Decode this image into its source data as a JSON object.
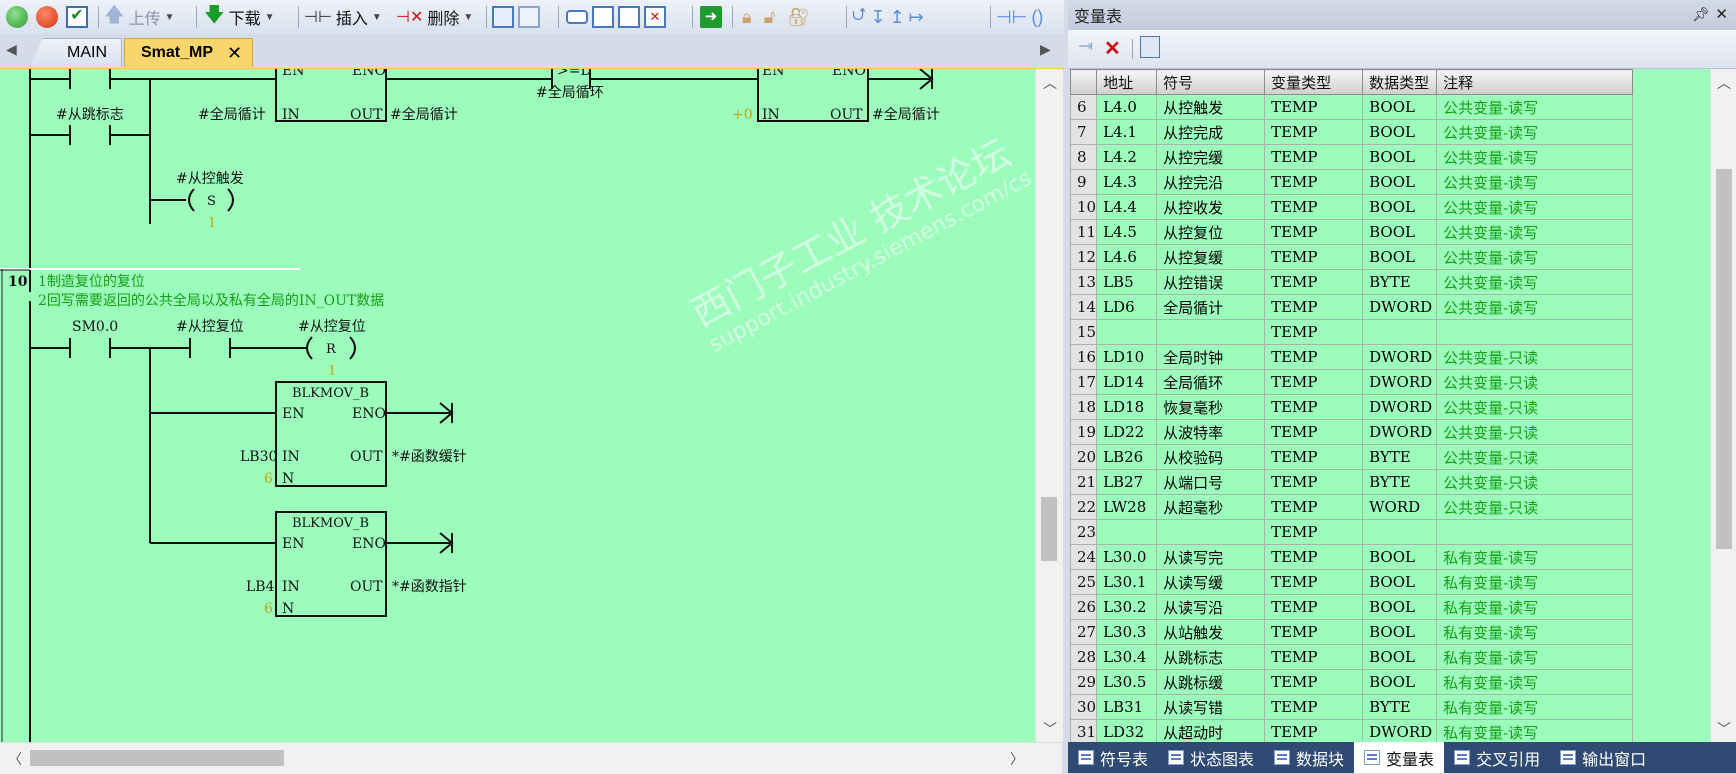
{
  "toolbar": {
    "upload": "上传",
    "download": "下载",
    "insert": "插入",
    "delete": "删除"
  },
  "editor_tabs": [
    {
      "label": "MAIN"
    },
    {
      "label": "Smat_MP"
    }
  ],
  "ladder": {
    "top": {
      "en": "EN",
      "eno": "ENO",
      "in": "IN",
      "out": "OUT",
      "contact2_label": "#从跳标志",
      "box1_in": "#全局循计",
      "box1_out": "#全局循计",
      "cmp_op": ">=D",
      "cmp_label": "#全局循环",
      "box2_in_value": "+0",
      "box2_out": "#全局循计",
      "set_coil_label": "#从控触发",
      "set_coil": "S",
      "set_n": "1"
    },
    "network10": {
      "number": "10",
      "comment1": "1制造复位的复位",
      "comment2": "2回写需要返回的公共全局以及私有全局的IN_OUT数据",
      "contact1": "SM0.0",
      "contact2": "#从控复位",
      "reset_label": "#从控复位",
      "reset_coil": "R",
      "reset_n": "1",
      "blk1": {
        "title": "BLKMOV_B",
        "in_src": "LB30",
        "n": "6",
        "out": "*#函数缓针"
      },
      "blk2": {
        "title": "BLKMOV_B",
        "in_src": "LB4",
        "n": "6",
        "out": "*#函数指针"
      },
      "en": "EN",
      "eno": "ENO",
      "in": "IN",
      "out": "OUT",
      "n_label": "N"
    }
  },
  "watermark": {
    "line1": "西门子工业 技术论坛",
    "line2": "support.industry.siemens.com/cs"
  },
  "panel": {
    "title": "变量表",
    "columns": [
      "地址",
      "符号",
      "变量类型",
      "数据类型",
      "注释"
    ],
    "rows": [
      [
        "6",
        "L4.0",
        "从控触发",
        "TEMP",
        "BOOL",
        "公共变量-读写"
      ],
      [
        "7",
        "L4.1",
        "从控完成",
        "TEMP",
        "BOOL",
        "公共变量-读写"
      ],
      [
        "8",
        "L4.2",
        "从控完缓",
        "TEMP",
        "BOOL",
        "公共变量-读写"
      ],
      [
        "9",
        "L4.3",
        "从控完沿",
        "TEMP",
        "BOOL",
        "公共变量-读写"
      ],
      [
        "10",
        "L4.4",
        "从控收发",
        "TEMP",
        "BOOL",
        "公共变量-读写"
      ],
      [
        "11",
        "L4.5",
        "从控复位",
        "TEMP",
        "BOOL",
        "公共变量-读写"
      ],
      [
        "12",
        "L4.6",
        "从控复缓",
        "TEMP",
        "BOOL",
        "公共变量-读写"
      ],
      [
        "13",
        "LB5",
        "从控错误",
        "TEMP",
        "BYTE",
        "公共变量-读写"
      ],
      [
        "14",
        "LD6",
        "全局循计",
        "TEMP",
        "DWORD",
        "公共变量-读写"
      ],
      [
        "15",
        "",
        "",
        "TEMP",
        "",
        ""
      ],
      [
        "16",
        "LD10",
        "全局时钟",
        "TEMP",
        "DWORD",
        "公共变量-只读"
      ],
      [
        "17",
        "LD14",
        "全局循环",
        "TEMP",
        "DWORD",
        "公共变量-只读"
      ],
      [
        "18",
        "LD18",
        "恢复毫秒",
        "TEMP",
        "DWORD",
        "公共变量-只读"
      ],
      [
        "19",
        "LD22",
        "从波特率",
        "TEMP",
        "DWORD",
        "公共变量-只读"
      ],
      [
        "20",
        "LB26",
        "从校验码",
        "TEMP",
        "BYTE",
        "公共变量-只读"
      ],
      [
        "21",
        "LB27",
        "从端口号",
        "TEMP",
        "BYTE",
        "公共变量-只读"
      ],
      [
        "22",
        "LW28",
        "从超毫秒",
        "TEMP",
        "WORD",
        "公共变量-只读"
      ],
      [
        "23",
        "",
        "",
        "TEMP",
        "",
        ""
      ],
      [
        "24",
        "L30.0",
        "从读写完",
        "TEMP",
        "BOOL",
        "私有变量-读写"
      ],
      [
        "25",
        "L30.1",
        "从读写缓",
        "TEMP",
        "BOOL",
        "私有变量-读写"
      ],
      [
        "26",
        "L30.2",
        "从读写沿",
        "TEMP",
        "BOOL",
        "私有变量-读写"
      ],
      [
        "27",
        "L30.3",
        "从站触发",
        "TEMP",
        "BOOL",
        "私有变量-读写"
      ],
      [
        "28",
        "L30.4",
        "从跳标志",
        "TEMP",
        "BOOL",
        "私有变量-读写"
      ],
      [
        "29",
        "L30.5",
        "从跳标缓",
        "TEMP",
        "BOOL",
        "私有变量-读写"
      ],
      [
        "30",
        "LB31",
        "从读写错",
        "TEMP",
        "BYTE",
        "私有变量-读写"
      ],
      [
        "31",
        "LD32",
        "从超动时",
        "TEMP",
        "DWORD",
        "私有变量-读写"
      ]
    ]
  },
  "bottom_tabs": [
    {
      "label": "符号表",
      "icon": "symbol-table-icon"
    },
    {
      "label": "状态图表",
      "icon": "status-chart-icon"
    },
    {
      "label": "数据块",
      "icon": "data-block-icon"
    },
    {
      "label": "变量表",
      "icon": "variable-table-icon"
    },
    {
      "label": "交叉引用",
      "icon": "cross-reference-icon"
    },
    {
      "label": "输出窗口",
      "icon": "output-window-icon"
    }
  ],
  "colors": {
    "ladder_bg": "#9cfcbc",
    "comment_green": "#12a012",
    "tab_active": "#f9d66b"
  }
}
